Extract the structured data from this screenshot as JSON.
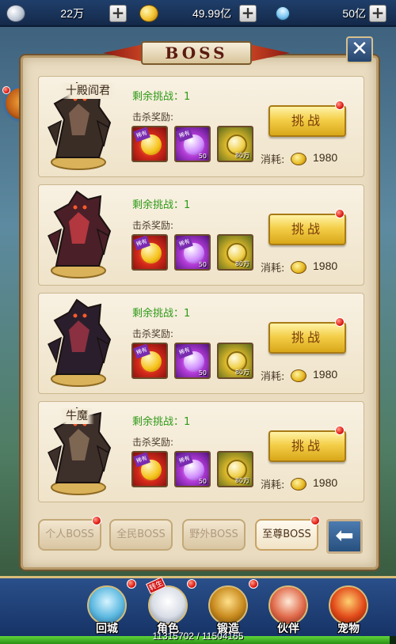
{
  "resources": {
    "silver": {
      "icon": "silver-coin-icon",
      "value": "22万"
    },
    "gold": {
      "icon": "gold-coin-icon",
      "value": "49.99亿"
    },
    "diamond": {
      "icon": "diamond-icon",
      "value": "50亿"
    }
  },
  "panel": {
    "title": "BOSS",
    "close_icon": "close-icon"
  },
  "bosses": [
    {
      "name": "十殿阎君",
      "remain": "剩余挑战：1",
      "reward_label": "击杀奖励:",
      "rewards": [
        {
          "tag": "稀有",
          "qty": ""
        },
        {
          "tag": "稀有",
          "qty": "50"
        },
        {
          "tag": "",
          "qty": "80万"
        }
      ],
      "button": "挑战",
      "cost_label": "消耗:",
      "cost": "1980"
    },
    {
      "name": "",
      "remain": "剩余挑战：1",
      "reward_label": "击杀奖励:",
      "rewards": [
        {
          "tag": "稀有",
          "qty": ""
        },
        {
          "tag": "稀有",
          "qty": "50"
        },
        {
          "tag": "",
          "qty": "80万"
        }
      ],
      "button": "挑战",
      "cost_label": "消耗:",
      "cost": "1980"
    },
    {
      "name": "",
      "remain": "剩余挑战：1",
      "reward_label": "击杀奖励:",
      "rewards": [
        {
          "tag": "稀有",
          "qty": ""
        },
        {
          "tag": "稀有",
          "qty": "50"
        },
        {
          "tag": "",
          "qty": "80万"
        }
      ],
      "button": "挑战",
      "cost_label": "消耗:",
      "cost": "1980"
    },
    {
      "name": "牛魔",
      "remain": "剩余挑战：1",
      "reward_label": "击杀奖励:",
      "rewards": [
        {
          "tag": "稀有",
          "qty": ""
        },
        {
          "tag": "稀有",
          "qty": "50"
        },
        {
          "tag": "",
          "qty": "80万"
        }
      ],
      "button": "挑战",
      "cost_label": "消耗:",
      "cost": "1980"
    }
  ],
  "tabs": [
    "个人BOSS",
    "全民BOSS",
    "野外BOSS",
    "至尊BOSS"
  ],
  "active_tab": "至尊BOSS",
  "back_icon": "arrow-left-icon",
  "nav": [
    {
      "label": "回城",
      "icon": "crystal-icon"
    },
    {
      "label": "角色",
      "icon": "character-icon",
      "badge": "转生"
    },
    {
      "label": "锻造",
      "icon": "forge-icon"
    },
    {
      "label": "伙伴",
      "icon": "partner-icon"
    },
    {
      "label": "宠物",
      "icon": "pet-icon"
    }
  ],
  "exp": {
    "text": "11315702 / 11504165",
    "fraction": 0.9836
  },
  "colors": {
    "accent_gold": "#f4cf49",
    "remain_green": "#2f9a18",
    "dot_red": "#e11b12"
  }
}
